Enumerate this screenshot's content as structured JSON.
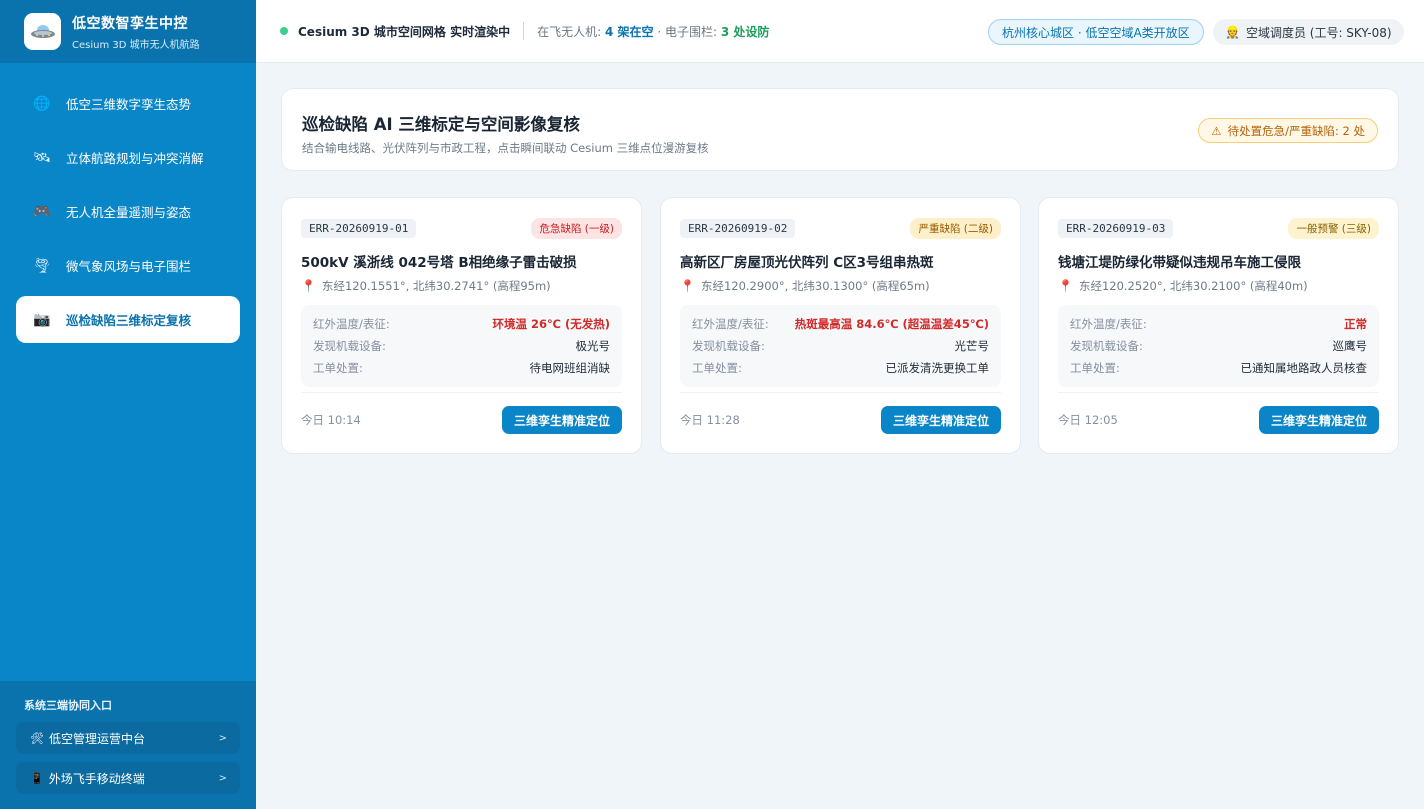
{
  "brand": {
    "title": "低空数智孪生中控",
    "subtitle": "Cesium 3D 城市无人机航路"
  },
  "nav": [
    {
      "label": "低空三维数字孪生态势",
      "icon": "globe-icon",
      "glyph": "🌐"
    },
    {
      "label": "立体航路规划与冲突消解",
      "icon": "satellite-icon",
      "glyph": "🛰"
    },
    {
      "label": "无人机全量遥测与姿态",
      "icon": "gamepad-icon",
      "glyph": "🎮"
    },
    {
      "label": "微气象风场与电子围栏",
      "icon": "tornado-icon",
      "glyph": "🌪"
    },
    {
      "label": "巡检缺陷三维标定复核",
      "icon": "camera-icon",
      "glyph": "📷"
    }
  ],
  "sidebar_bottom": {
    "title": "系统三端协同入口",
    "links": [
      {
        "label": "低空管理运营中台",
        "icon": "tools-icon",
        "glyph": "🛠",
        "arrow": ">"
      },
      {
        "label": "外场飞手移动终端",
        "icon": "mobile-icon",
        "glyph": "📱",
        "arrow": ">"
      }
    ]
  },
  "topbar": {
    "status_main": "Cesium 3D 城市空间网格 实时渲染中",
    "status_prefix": "在飞无人机:",
    "drones_in_air": "4 架在空",
    "fence_prefix": "· 电子围栏:",
    "fences": "3 处设防",
    "zone": "杭州核心城区 · 低空空域A类开放区",
    "user": "空域调度员 (工号: SKY-08)",
    "user_icon": "👷"
  },
  "header": {
    "title": "巡检缺陷 AI 三维标定与空间影像复核",
    "subtitle": "结合输电线路、光伏阵列与市政工程，点击瞬间联动 Cesium 三维点位漫游复核",
    "warning": "待处置危急/严重缺陷: 2 处",
    "warning_icon": "⚠"
  },
  "labels": {
    "k1": "红外温度/表征:",
    "k2": "发现机载设备:",
    "k3": "工单处置:",
    "locate_button": "三维孪生精准定位"
  },
  "cards": [
    {
      "id": "ERR-20260919-01",
      "level": "危急缺陷 (一级)",
      "title": "500kV 溪浙线 042号塔 B相绝缘子雷击破损",
      "location": "东经120.1551°, 北纬30.2741° (高程95m)",
      "temp": "环境温 26℃ (无发热)",
      "device": "极光号",
      "ticket": "待电网班组消缺",
      "time": "今日 10:14"
    },
    {
      "id": "ERR-20260919-02",
      "level": "严重缺陷 (二级)",
      "title": "高新区厂房屋顶光伏阵列 C区3号组串热斑",
      "location": "东经120.2900°, 北纬30.1300° (高程65m)",
      "temp": "热斑最高温 84.6℃ (超温温差45℃)",
      "device": "光芒号",
      "ticket": "已派发清洗更换工单",
      "time": "今日 11:28"
    },
    {
      "id": "ERR-20260919-03",
      "level": "一般预警 (三级)",
      "title": "钱塘江堤防绿化带疑似违规吊车施工侵限",
      "location": "东经120.2520°, 北纬30.2100° (高程40m)",
      "temp": "正常",
      "device": "巡鹰号",
      "ticket": "已通知属地路政人员核查",
      "time": "今日 12:05"
    }
  ]
}
